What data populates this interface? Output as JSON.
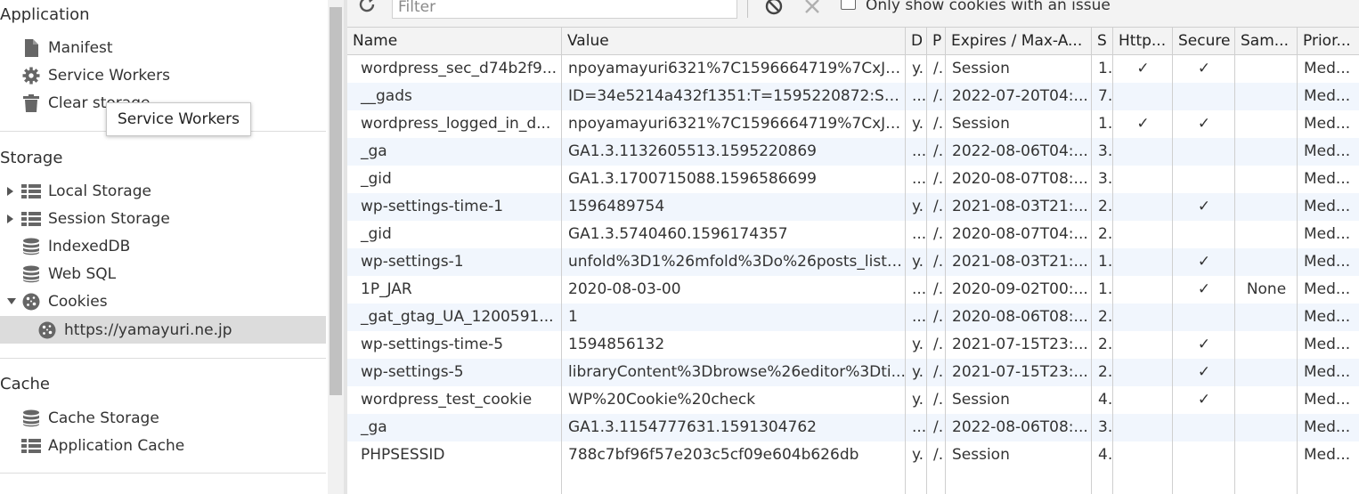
{
  "sidebar": {
    "sections": {
      "application": "Application",
      "storage": "Storage",
      "cache": "Cache"
    },
    "application_items": [
      "Manifest",
      "Service Workers",
      "Clear storage"
    ],
    "storage_items": [
      "Local Storage",
      "Session Storage",
      "IndexedDB",
      "Web SQL",
      "Cookies"
    ],
    "cookie_origin": "https://yamayuri.ne.jp",
    "cache_items": [
      "Cache Storage",
      "Application Cache"
    ],
    "tooltip": "Service Workers"
  },
  "toolbar": {
    "filter_placeholder": "Filter",
    "only_issues_label": "Only show cookies with an issue"
  },
  "table": {
    "headers": [
      "Name",
      "Value",
      "D",
      "P",
      "Expires / Max-A...",
      "S",
      "Http...",
      "Secure",
      "Sam...",
      "Prior..."
    ],
    "rows": [
      [
        "wordpress_sec_d74b2f9...",
        "npoyamayuri6321%7C1596664719%7CxJv...",
        "y.",
        "/.",
        "Session",
        "1.",
        "✓",
        "✓",
        "",
        "Med..."
      ],
      [
        "__gads",
        "ID=34e5214a432f1351:T=1595220872:S=A...",
        "...",
        "/.",
        "2022-07-20T04:...",
        "7.",
        "",
        "",
        "",
        "Med..."
      ],
      [
        "wordpress_logged_in_d...",
        "npoyamayuri6321%7C1596664719%7CxJv...",
        "y.",
        "/.",
        "Session",
        "1.",
        "✓",
        "✓",
        "",
        "Med..."
      ],
      [
        "_ga",
        "GA1.3.1132605513.1595220869",
        "...",
        "/.",
        "2022-08-06T04:...",
        "3.",
        "",
        "",
        "",
        "Med..."
      ],
      [
        "_gid",
        "GA1.3.1700715088.1596586699",
        "...",
        "/.",
        "2020-08-07T08:...",
        "3.",
        "",
        "",
        "",
        "Med..."
      ],
      [
        "wp-settings-time-1",
        "1596489754",
        "y.",
        "/.",
        "2021-08-03T21:...",
        "2.",
        "",
        "✓",
        "",
        "Med..."
      ],
      [
        "_gid",
        "GA1.3.5740460.1596174357",
        "...",
        "/.",
        "2020-08-07T04:...",
        "2.",
        "",
        "",
        "",
        "Med..."
      ],
      [
        "wp-settings-1",
        "unfold%3D1%26mfold%3Do%26posts_list_...",
        "y.",
        "/.",
        "2021-08-03T21:...",
        "1.",
        "",
        "✓",
        "",
        "Med..."
      ],
      [
        "1P_JAR",
        "2020-08-03-00",
        "...",
        "/.",
        "2020-09-02T00:...",
        "1.",
        "",
        "✓",
        "None",
        "Med..."
      ],
      [
        "_gat_gtag_UA_1200591...",
        "1",
        "...",
        "/.",
        "2020-08-06T08:...",
        "2.",
        "",
        "",
        "",
        "Med..."
      ],
      [
        "wp-settings-time-5",
        "1594856132",
        "y.",
        "/.",
        "2021-07-15T23:...",
        "2.",
        "",
        "✓",
        "",
        "Med..."
      ],
      [
        "wp-settings-5",
        "libraryContent%3Dbrowse%26editor%3Dti...",
        "y.",
        "/.",
        "2021-07-15T23:...",
        "2.",
        "",
        "✓",
        "",
        "Med..."
      ],
      [
        "wordpress_test_cookie",
        "WP%20Cookie%20check",
        "y.",
        "/.",
        "Session",
        "4.",
        "",
        "✓",
        "",
        "Med..."
      ],
      [
        "_ga",
        "GA1.3.1154777631.1591304762",
        "...",
        "/.",
        "2022-08-06T08:...",
        "3.",
        "",
        "",
        "",
        "Med..."
      ],
      [
        "PHPSESSID",
        "788c7bf96f57e203c5cf09e604b626db",
        "y.",
        "/.",
        "Session",
        "4.",
        "",
        "",
        "",
        "Med..."
      ]
    ]
  }
}
